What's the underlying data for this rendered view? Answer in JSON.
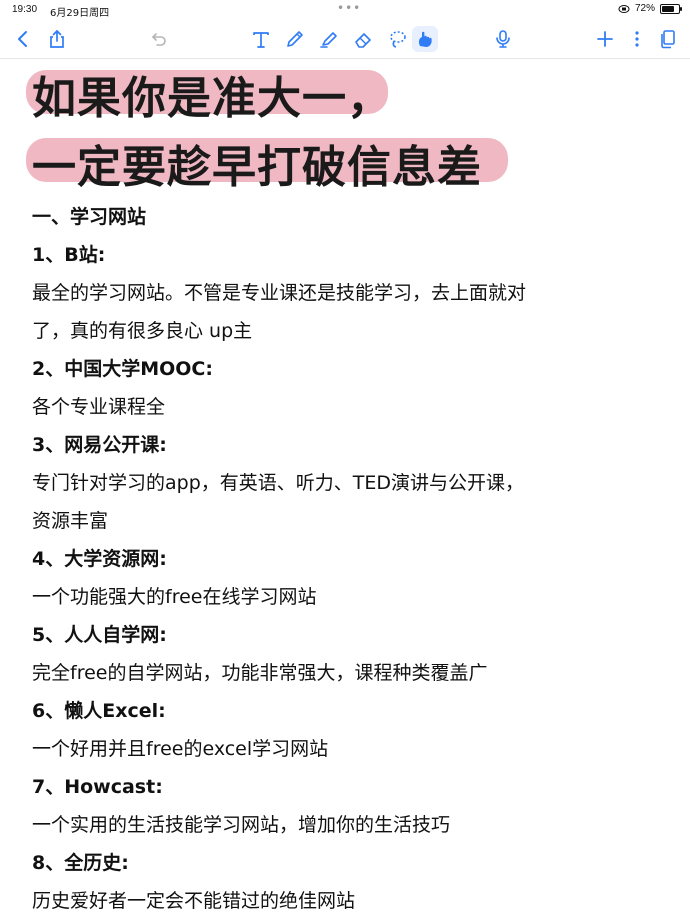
{
  "status": {
    "time": "19:30",
    "date": "6月29日周四",
    "dots": "•••",
    "battery_text": "72%",
    "battery_level": 0.72
  },
  "toolbar": {
    "icons": [
      "back-icon",
      "share-icon",
      "undo-icon",
      "text-icon",
      "pen-icon",
      "highlighter-icon",
      "eraser-icon",
      "lasso-icon",
      "hand-draw-icon",
      "mic-icon",
      "add-icon",
      "more-icon",
      "pages-icon"
    ],
    "accent": "#2f7cf6"
  },
  "document": {
    "title_line1": "如果你是准大一，",
    "title_line2": "一定要趁早打破信息差",
    "highlight_color": "#efb8c2",
    "section_heading": "一、学习网站",
    "items": [
      {
        "heading": "1、B站:",
        "desc": [
          "最全的学习网站。不管是专业课还是技能学习，去上面就对",
          "了，真的有很多良心 up主"
        ]
      },
      {
        "heading": "2、中国大学MOOC:",
        "desc": [
          "各个专业课程全"
        ]
      },
      {
        "heading": "3、网易公开课:",
        "desc": [
          "专门针对学习的app，有英语、听力、TED演讲与公开课，",
          "资源丰富"
        ]
      },
      {
        "heading": "4、大学资源网:",
        "desc": [
          "一个功能强大的free在线学习网站"
        ]
      },
      {
        "heading": "5、人人自学网:",
        "desc": [
          "完全free的自学网站，功能非常强大，课程种类覆盖广"
        ]
      },
      {
        "heading": "6、懒人Excel:",
        "desc": [
          "一个好用并且free的excel学习网站"
        ]
      },
      {
        "heading": "7、Howcast:",
        "desc": [
          "一个实用的生活技能学习网站，增加你的生活技巧"
        ]
      },
      {
        "heading": "8、全历史:",
        "desc": [
          "历史爱好者一定会不能错过的绝佳网站"
        ]
      }
    ]
  }
}
